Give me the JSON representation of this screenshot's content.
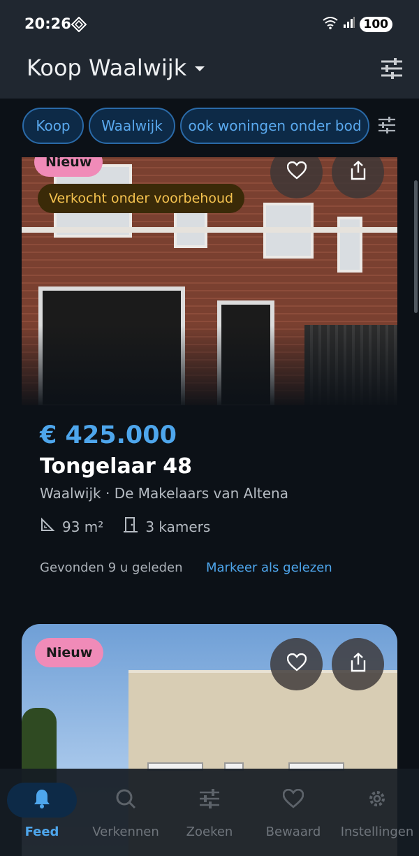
{
  "status_bar": {
    "time": "20:26",
    "battery": "100",
    "left_icon": "diamond-signal-icon",
    "right_icons": [
      "wifi-icon",
      "signal-icon",
      "battery-icon"
    ]
  },
  "app_bar": {
    "title": "Koop Waalwijk",
    "filter_icon": "tune-icon"
  },
  "chips": [
    {
      "label": "Koop"
    },
    {
      "label": "Waalwijk"
    },
    {
      "label": "ook woningen onder bod"
    }
  ],
  "listings": [
    {
      "badge_new": "Nieuw",
      "badge_status": "Verkocht onder voorbehoud",
      "price": "€ 425.000",
      "address": "Tongelaar 48",
      "subline": "Waalwijk · De Makelaars van Altena",
      "area": "93 m²",
      "rooms": "3 kamers",
      "found": "Gevonden 9 u geleden",
      "mark_read": "Markeer als gelezen"
    },
    {
      "badge_new": "Nieuw"
    }
  ],
  "nav": {
    "items": [
      {
        "label": "Feed",
        "icon": "bell-icon",
        "active": true
      },
      {
        "label": "Verkennen",
        "icon": "explore-icon",
        "active": false
      },
      {
        "label": "Zoeken",
        "icon": "tune-icon",
        "active": false
      },
      {
        "label": "Bewaard",
        "icon": "heart-icon",
        "active": false
      },
      {
        "label": "Instellingen",
        "icon": "gear-icon",
        "active": false
      }
    ]
  },
  "colors": {
    "accent": "#4ea6ec",
    "background": "#0c1117",
    "app_bar": "#202730",
    "badge_new": "#f08bb8",
    "badge_status_text": "#f4c24f"
  }
}
